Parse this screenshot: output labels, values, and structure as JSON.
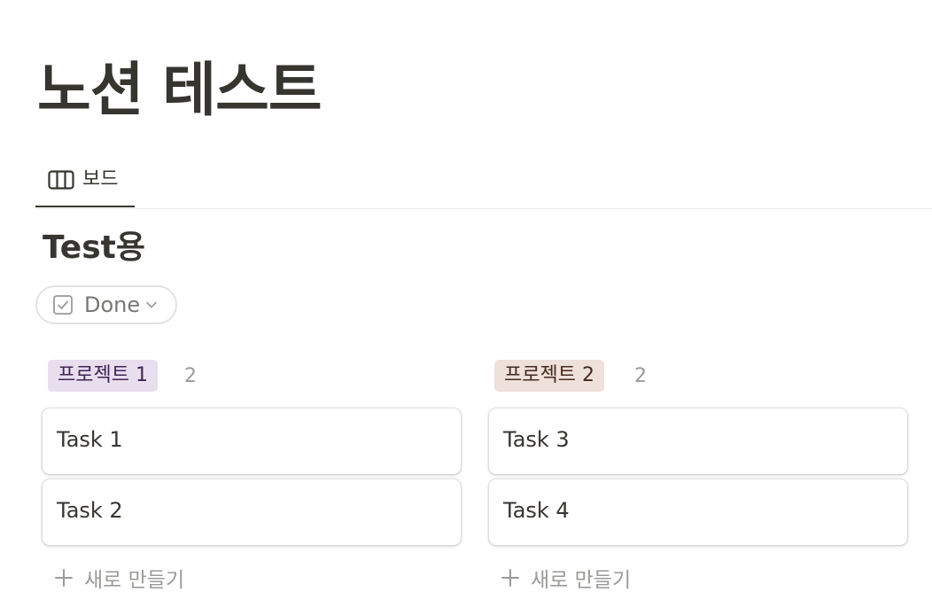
{
  "page": {
    "title": "노션 테스트"
  },
  "view_tabs": [
    {
      "icon": "board-view-icon",
      "label": "보드"
    }
  ],
  "database": {
    "title": "Test용"
  },
  "filter": {
    "icon": "checkbox-icon",
    "label": "Done"
  },
  "columns": [
    {
      "tag": "프로젝트 1",
      "tag_bg": "#e8deee",
      "tag_color": "#412454",
      "count": "2",
      "cards": [
        {
          "title": "Task 1"
        },
        {
          "title": "Task 2"
        }
      ],
      "new_label": "새로 만들기"
    },
    {
      "tag": "프로젝트 2",
      "tag_bg": "#eee0da",
      "tag_color": "#442a1e",
      "count": "2",
      "cards": [
        {
          "title": "Task 3"
        },
        {
          "title": "Task 4"
        }
      ],
      "new_label": "새로 만들기"
    }
  ],
  "colors": {
    "text": "#37352f",
    "muted": "#9b9a97",
    "divider": "#e9e9e7"
  }
}
